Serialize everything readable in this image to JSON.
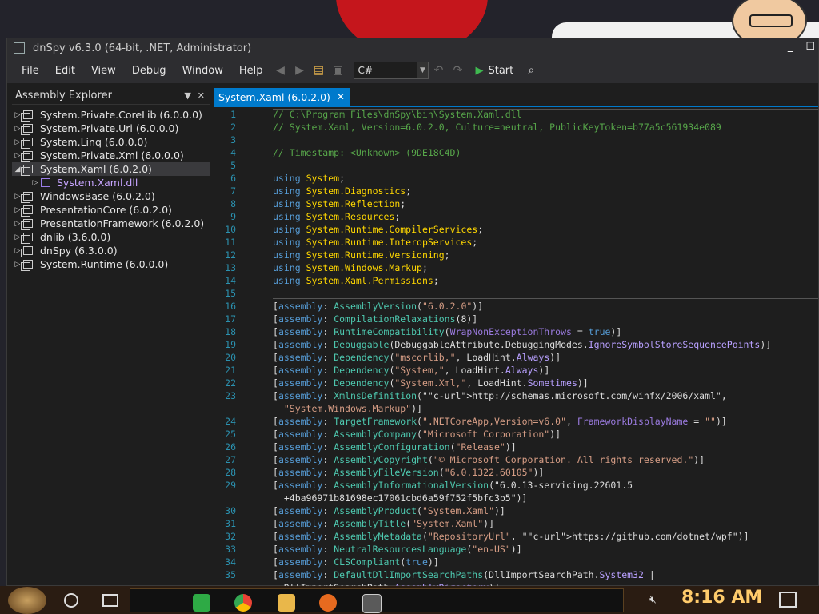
{
  "window": {
    "title": "dnSpy v6.3.0 (64-bit, .NET, Administrator)",
    "controls": [
      "_",
      "☐"
    ]
  },
  "menu": [
    "File",
    "Edit",
    "View",
    "Debug",
    "Window",
    "Help"
  ],
  "toolbar": {
    "language": "C#",
    "start_label": "Start"
  },
  "explorer": {
    "title": "Assembly Explorer",
    "items": [
      {
        "label": "System.Private.CoreLib (6.0.0.0)",
        "expanded": false
      },
      {
        "label": "System.Private.Uri (6.0.0.0)",
        "expanded": false
      },
      {
        "label": "System.Linq (6.0.0.0)",
        "expanded": false
      },
      {
        "label": "System.Private.Xml (6.0.0.0)",
        "expanded": false
      },
      {
        "label": "System.Xaml (6.0.2.0)",
        "expanded": true,
        "selected": true
      },
      {
        "label": "System.Xaml.dll",
        "child": true
      },
      {
        "label": "WindowsBase (6.0.2.0)",
        "expanded": false
      },
      {
        "label": "PresentationCore (6.0.2.0)",
        "expanded": false
      },
      {
        "label": "PresentationFramework (6.0.2.0)",
        "expanded": false
      },
      {
        "label": "dnlib (3.6.0.0)",
        "expanded": false
      },
      {
        "label": "dnSpy (6.3.0.0)",
        "expanded": false
      },
      {
        "label": "System.Runtime (6.0.0.0)",
        "expanded": false
      }
    ]
  },
  "tab": {
    "label": "System.Xaml (6.0.2.0)"
  },
  "code_lines": [
    {
      "n": "1",
      "text": "// C:\\Program Files\\dnSpy\\bin\\System.Xaml.dll"
    },
    {
      "n": "2",
      "text": "// System.Xaml, Version=6.0.2.0, Culture=neutral, PublicKeyToken=b77a5c561934e089"
    },
    {
      "n": "3",
      "text": ""
    },
    {
      "n": "4",
      "text": "// Timestamp: <Unknown> (9DE18C4D)"
    },
    {
      "n": "5",
      "text": ""
    },
    {
      "n": "6",
      "text": "using System;"
    },
    {
      "n": "7",
      "text": "using System.Diagnostics;"
    },
    {
      "n": "8",
      "text": "using System.Reflection;"
    },
    {
      "n": "9",
      "text": "using System.Resources;"
    },
    {
      "n": "10",
      "text": "using System.Runtime.CompilerServices;"
    },
    {
      "n": "11",
      "text": "using System.Runtime.InteropServices;"
    },
    {
      "n": "12",
      "text": "using System.Runtime.Versioning;"
    },
    {
      "n": "13",
      "text": "using System.Windows.Markup;"
    },
    {
      "n": "14",
      "text": "using System.Xaml.Permissions;"
    },
    {
      "n": "15",
      "text": ""
    },
    {
      "n": "16",
      "text": "[assembly: AssemblyVersion(\"6.0.2.0\")]"
    },
    {
      "n": "17",
      "text": "[assembly: CompilationRelaxations(8)]"
    },
    {
      "n": "18",
      "text": "[assembly: RuntimeCompatibility(WrapNonExceptionThrows = true)]"
    },
    {
      "n": "19",
      "text": "[assembly: Debuggable(DebuggableAttribute.DebuggingModes.IgnoreSymbolStoreSequencePoints)]"
    },
    {
      "n": "20",
      "text": "[assembly: Dependency(\"mscorlib,\", LoadHint.Always)]"
    },
    {
      "n": "21",
      "text": "[assembly: Dependency(\"System,\", LoadHint.Always)]"
    },
    {
      "n": "22",
      "text": "[assembly: Dependency(\"System.Xml,\", LoadHint.Sometimes)]"
    },
    {
      "n": "23",
      "text": "[assembly: XmlnsDefinition(\"http://schemas.microsoft.com/winfx/2006/xaml\","
    },
    {
      "n": "",
      "text": "  \"System.Windows.Markup\")]"
    },
    {
      "n": "24",
      "text": "[assembly: TargetFramework(\".NETCoreApp,Version=v6.0\", FrameworkDisplayName = \"\")]"
    },
    {
      "n": "25",
      "text": "[assembly: AssemblyCompany(\"Microsoft Corporation\")]"
    },
    {
      "n": "26",
      "text": "[assembly: AssemblyConfiguration(\"Release\")]"
    },
    {
      "n": "27",
      "text": "[assembly: AssemblyCopyright(\"© Microsoft Corporation. All rights reserved.\")]"
    },
    {
      "n": "28",
      "text": "[assembly: AssemblyFileVersion(\"6.0.1322.60105\")]"
    },
    {
      "n": "29",
      "text": "[assembly: AssemblyInformationalVersion(\"6.0.13-servicing.22601.5"
    },
    {
      "n": "",
      "text": "  +4ba96971b81698ec17061cbd6a59f752f5bfc3b5\")]"
    },
    {
      "n": "30",
      "text": "[assembly: AssemblyProduct(\"System.Xaml\")]"
    },
    {
      "n": "31",
      "text": "[assembly: AssemblyTitle(\"System.Xaml\")]"
    },
    {
      "n": "32",
      "text": "[assembly: AssemblyMetadata(\"RepositoryUrl\", \"https://github.com/dotnet/wpf\")]"
    },
    {
      "n": "33",
      "text": "[assembly: NeutralResourcesLanguage(\"en-US\")]"
    },
    {
      "n": "34",
      "text": "[assembly: CLSCompliant(true)]"
    },
    {
      "n": "35",
      "text": "[assembly: DefaultDllImportSearchPaths(DllImportSearchPath.System32 |"
    },
    {
      "n": "",
      "text": "  DllImportSearchPath.AssemblyDirectory)]"
    }
  ],
  "taskbar": {
    "time": "8:16 AM"
  },
  "colors": {
    "accent": "#007acc",
    "keyword": "#569cd6",
    "namespace": "#ffd700",
    "comment": "#57a64a",
    "attribute": "#4ec9b0",
    "string": "#d69d85",
    "clock": "#ffcb6b"
  }
}
